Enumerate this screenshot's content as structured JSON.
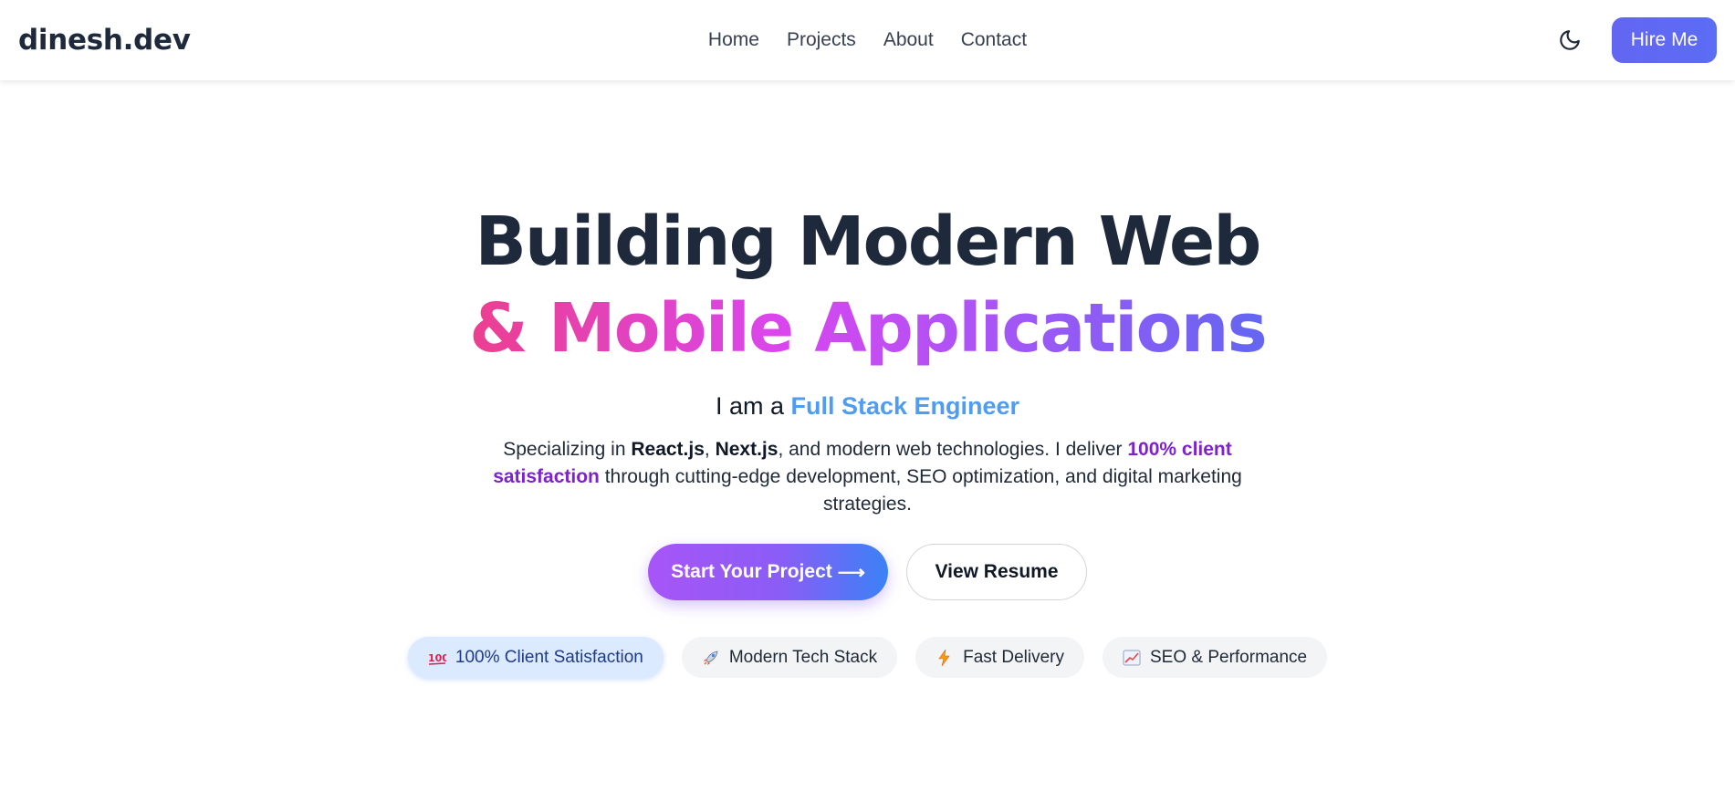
{
  "nav": {
    "logo": "dinesh.dev",
    "links": [
      {
        "label": "Home"
      },
      {
        "label": "Projects"
      },
      {
        "label": "About"
      },
      {
        "label": "Contact"
      }
    ],
    "theme_icon": "moon-icon",
    "hire_label": "Hire Me"
  },
  "hero": {
    "headline_line1": "Building Modern Web",
    "headline_line2": "& Mobile Applications",
    "subtitle_prefix": "I am a",
    "subtitle_role": "Full Stack Engineer",
    "description": {
      "p1": "Specializing in ",
      "b1": "React.js",
      "sep": ", ",
      "b2": "Next.js",
      "p2": ", and modern web technologies. I deliver ",
      "highlight": "100% client satisfaction",
      "p3": " through cutting-edge development, SEO optimization, and digital marketing strategies."
    },
    "primary_cta": "Start Your Project",
    "primary_cta_arrow": "⟶",
    "secondary_cta": "View Resume"
  },
  "badges": [
    {
      "icon": "hundred-points-icon",
      "label": "100% Client Satisfaction",
      "active": true
    },
    {
      "icon": "rocket-icon",
      "label": "Modern Tech Stack",
      "active": false
    },
    {
      "icon": "lightning-icon",
      "label": "Fast Delivery",
      "active": false
    },
    {
      "icon": "chart-increasing-icon",
      "label": "SEO & Performance",
      "active": false
    }
  ],
  "colors": {
    "accent_blue": "#4f9cf0",
    "accent_purple": "#7e22ce",
    "gradient_pink": "#ec3f8f",
    "gradient_indigo": "#6366f1",
    "text_dark": "#1e293b"
  }
}
